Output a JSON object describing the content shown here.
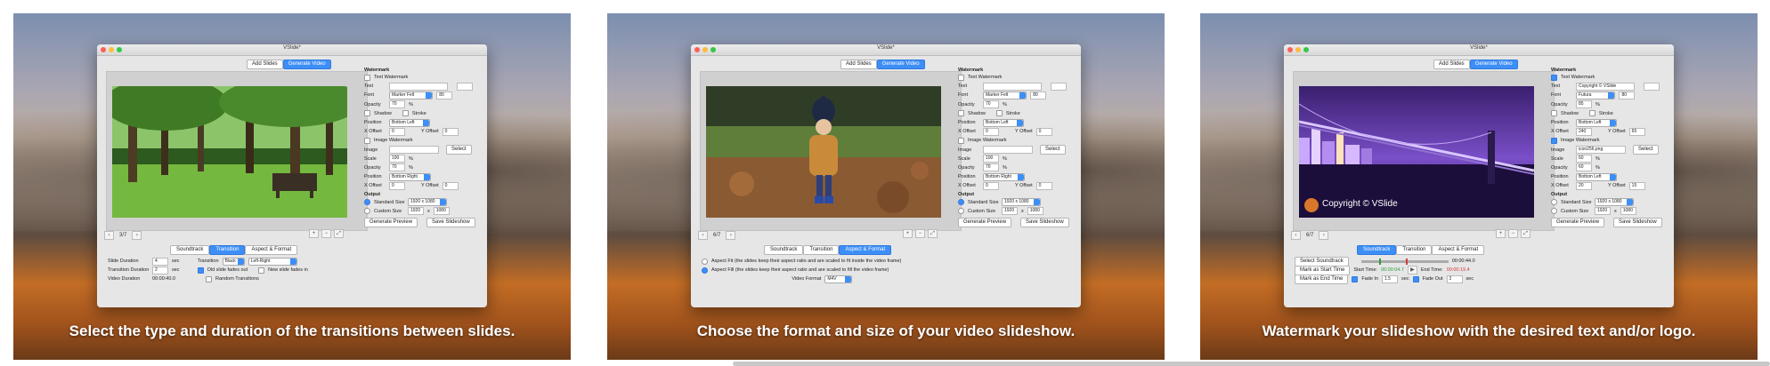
{
  "panels": [
    {
      "caption": "Select the type and duration of the transitions between slides.",
      "window_title": "VSlide*",
      "top_buttons": [
        "Add Slides",
        "Generate Video"
      ],
      "slide_counter": "3/7",
      "tabs": [
        "Soundtrack",
        "Transition",
        "Aspect & Format"
      ],
      "active_tab": 1,
      "transition": {
        "slide_duration_label": "Slide Duration",
        "slide_duration_value": "4",
        "slide_duration_unit": "sec",
        "transition_label": "Transition",
        "transition_value": "Black",
        "transition_direction": "Left-Right",
        "transition_duration_label": "Transition Duration",
        "transition_duration_value": "2",
        "transition_duration_unit": "sec",
        "old_fades_label": "Old slide fades out",
        "new_fades_label": "New slide fades in",
        "random_label": "Random Transitions",
        "video_duration_label": "Video Duration",
        "video_duration_value": "00:00:40.0"
      },
      "side": {
        "watermark_heading": "Watermark",
        "text_watermark_label": "Text Watermark",
        "text_watermark_checked": false,
        "text_label": "Text",
        "text_value": "",
        "font_label": "Font",
        "font_value": "Marker Felt",
        "font_size": "80",
        "opacity_label": "Opacity",
        "opacity_value": "70",
        "percent": "%",
        "shadow_label": "Shadow",
        "stroke_label": "Stroke",
        "position_label": "Position",
        "position_value": "Bottom Left",
        "xoffset_label": "X Offset",
        "xoffset_value": "0",
        "yoffset_label": "Y Offset",
        "yoffset_value": "0",
        "image_watermark_label": "Image Watermark",
        "image_watermark_checked": false,
        "image_label": "Image",
        "image_value": "",
        "select_label": "Select",
        "scale_label": "Scale",
        "scale_value": "100",
        "img_opacity_value": "70",
        "img_position_value": "Bottom Right",
        "img_xoffset_value": "0",
        "img_yoffset_value": "0",
        "output_heading": "Output",
        "standard_size_label": "Standard Size",
        "standard_size_value": "1920 x 1080",
        "custom_size_label": "Custom Size",
        "custom_w": "1920",
        "custom_x": "x",
        "custom_h": "1080",
        "preview_label": "Generate Preview",
        "slideshow_label": "Save Slideshow"
      }
    },
    {
      "caption": "Choose the format and size of your video slideshow.",
      "window_title": "VSlide*",
      "top_buttons": [
        "Add Slides",
        "Generate Video"
      ],
      "slide_counter": "6/7",
      "tabs": [
        "Soundtrack",
        "Transition",
        "Aspect & Format"
      ],
      "active_tab": 2,
      "aspect": {
        "fit_label": "Aspect Fit (the slides keep their aspect ratio and are scaled to fit inside the video frame)",
        "fill_label": "Aspect Fill (the slides keep their aspect ratio and are scaled to fill the video frame)",
        "video_format_label": "Video Format",
        "video_format_value": "M4V"
      },
      "side": {
        "watermark_heading": "Watermark",
        "text_watermark_label": "Text Watermark",
        "text_watermark_checked": false,
        "text_label": "Text",
        "text_value": "",
        "font_label": "Font",
        "font_value": "Marker Felt",
        "font_size": "80",
        "opacity_label": "Opacity",
        "opacity_value": "70",
        "percent": "%",
        "shadow_label": "Shadow",
        "stroke_label": "Stroke",
        "position_label": "Position",
        "position_value": "Bottom Left",
        "xoffset_label": "X Offset",
        "xoffset_value": "0",
        "yoffset_label": "Y Offset",
        "yoffset_value": "0",
        "image_watermark_label": "Image Watermark",
        "image_watermark_checked": false,
        "image_label": "Image",
        "image_value": "",
        "select_label": "Select",
        "scale_label": "Scale",
        "scale_value": "100",
        "img_opacity_value": "70",
        "img_position_value": "Bottom Right",
        "img_xoffset_value": "0",
        "img_yoffset_value": "0",
        "output_heading": "Output",
        "standard_size_label": "Standard Size",
        "standard_size_value": "1920 x 1080",
        "custom_size_label": "Custom Size",
        "custom_w": "1920",
        "custom_x": "x",
        "custom_h": "1080",
        "preview_label": "Generate Preview",
        "slideshow_label": "Save Slideshow"
      }
    },
    {
      "caption": "Watermark your slideshow with the desired text and/or logo.",
      "window_title": "VSlide*",
      "top_buttons": [
        "Add Slides",
        "Generate Video"
      ],
      "slide_counter": "6/7",
      "tabs": [
        "Soundtrack",
        "Transition",
        "Aspect & Format"
      ],
      "active_tab": 0,
      "photo_watermark": "Copyright © VSlide",
      "soundtrack": {
        "select_label": "Select Soundtrack",
        "time_readout": "00:00:44.0",
        "mark_start_label": "Mark as Start Time",
        "start_time_label": "Start Time:",
        "start_time_value": "00:00:04.7",
        "end_time_label": "End Time:",
        "end_time_value": "00:00:19.4",
        "mark_end_label": "Mark as End Time",
        "fade_in_label": "Fade In",
        "fade_in_value": "1.5",
        "fade_in_unit": "sec",
        "fade_out_label": "Fade Out",
        "fade_out_value": "2",
        "fade_out_unit": "sec"
      },
      "side": {
        "watermark_heading": "Watermark",
        "text_watermark_label": "Text Watermark",
        "text_watermark_checked": true,
        "text_label": "Text",
        "text_value": "Copyright © VSlide",
        "font_label": "Font",
        "font_value": "Futura",
        "font_size": "80",
        "opacity_label": "Opacity",
        "opacity_value": "85",
        "percent": "%",
        "shadow_label": "Shadow",
        "stroke_label": "Stroke",
        "position_label": "Position",
        "position_value": "Bottom Left",
        "xoffset_label": "X Offset",
        "xoffset_value": "240",
        "yoffset_label": "Y Offset",
        "yoffset_value": "65",
        "image_watermark_label": "Image Watermark",
        "image_watermark_checked": true,
        "image_label": "Image",
        "image_value": "icon256.png",
        "select_label": "Select",
        "scale_label": "Scale",
        "scale_value": "60",
        "img_opacity_value": "60",
        "img_position_value": "Bottom Left",
        "img_xoffset_value": "20",
        "img_yoffset_value": "15",
        "output_heading": "Output",
        "standard_size_label": "Standard Size",
        "standard_size_value": "1920 x 1080",
        "custom_size_label": "Custom Size",
        "custom_w": "1920",
        "custom_x": "x",
        "custom_h": "1080",
        "preview_label": "Generate Preview",
        "slideshow_label": "Save Slideshow"
      }
    }
  ],
  "colors": {
    "accent": "#3d8ef6",
    "start_time": "#2e9c3c",
    "end_time": "#d43b3b"
  }
}
